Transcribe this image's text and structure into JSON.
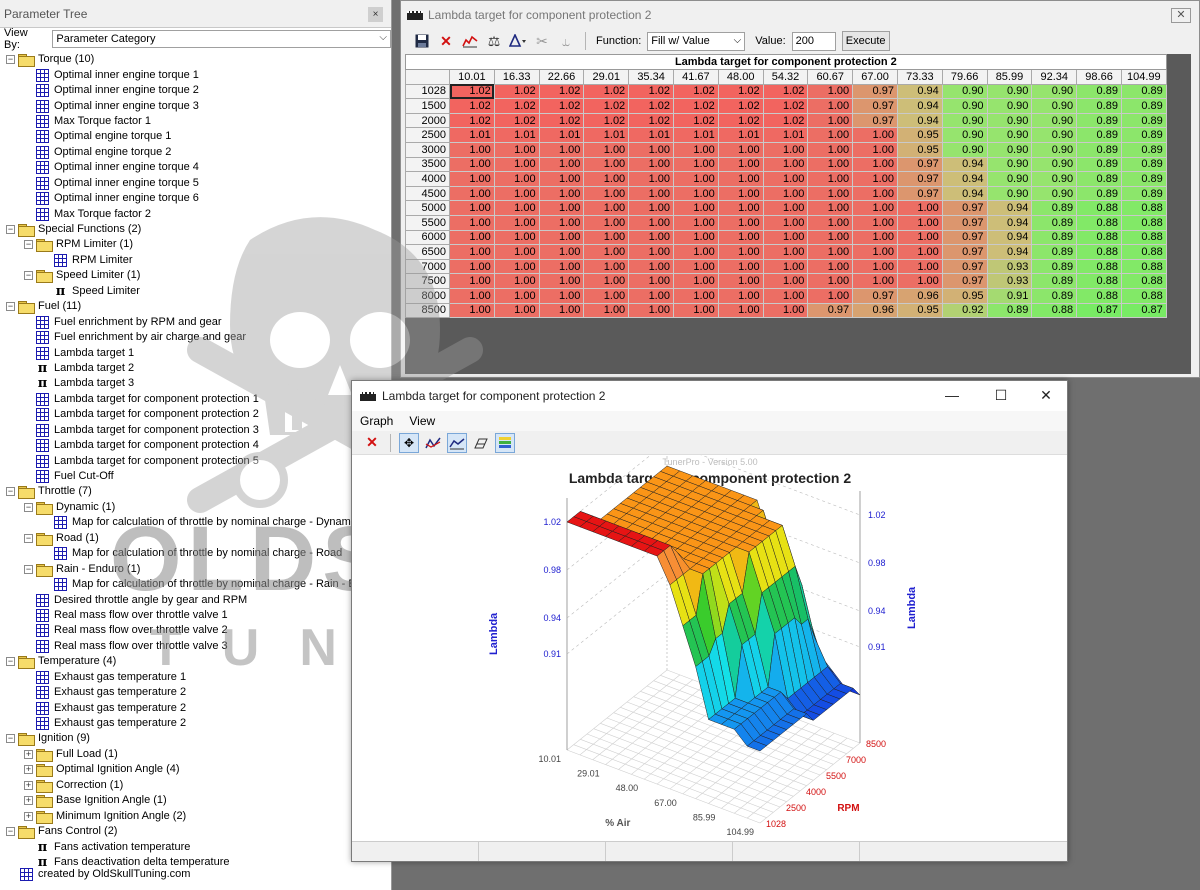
{
  "tree_panel": {
    "title": "Parameter Tree",
    "close_icon": "×",
    "view_by_label": "View By:",
    "view_by_value": "Parameter Category",
    "footer": "created by OldSkullTuning.com",
    "items": [
      {
        "level": 0,
        "type": "folder",
        "label": "Torque (10)",
        "expander": "−"
      },
      {
        "level": 1,
        "type": "grid",
        "label": "Optimal inner engine torque 1"
      },
      {
        "level": 1,
        "type": "grid",
        "label": "Optimal inner engine torque 2"
      },
      {
        "level": 1,
        "type": "grid",
        "label": "Optimal inner engine torque 3"
      },
      {
        "level": 1,
        "type": "grid",
        "label": "Max Torque factor 1"
      },
      {
        "level": 1,
        "type": "grid",
        "label": "Optimal engine torque 1"
      },
      {
        "level": 1,
        "type": "grid",
        "label": "Optimal engine torque 2"
      },
      {
        "level": 1,
        "type": "grid",
        "label": "Optimal inner engine torque 4"
      },
      {
        "level": 1,
        "type": "grid",
        "label": "Optimal inner engine torque 5"
      },
      {
        "level": 1,
        "type": "grid",
        "label": "Optimal inner engine torque 6"
      },
      {
        "level": 1,
        "type": "grid",
        "label": "Max Torque factor 2"
      },
      {
        "level": 0,
        "type": "folder",
        "label": "Special Functions (2)",
        "expander": "−"
      },
      {
        "level": 1,
        "type": "folder",
        "label": "RPM Limiter (1)",
        "expander": "−"
      },
      {
        "level": 2,
        "type": "grid",
        "label": "RPM Limiter"
      },
      {
        "level": 1,
        "type": "folder",
        "label": "Speed Limiter (1)",
        "expander": "−"
      },
      {
        "level": 2,
        "type": "pi",
        "label": "Speed Limiter"
      },
      {
        "level": 0,
        "type": "folder",
        "label": "Fuel (11)",
        "expander": "−"
      },
      {
        "level": 1,
        "type": "grid",
        "label": "Fuel enrichment by RPM and gear"
      },
      {
        "level": 1,
        "type": "grid",
        "label": "Fuel enrichment by air charge and gear"
      },
      {
        "level": 1,
        "type": "grid",
        "label": "Lambda target 1"
      },
      {
        "level": 1,
        "type": "pi",
        "label": "Lambda target 2"
      },
      {
        "level": 1,
        "type": "pi",
        "label": "Lambda target 3"
      },
      {
        "level": 1,
        "type": "grid",
        "label": "Lambda target for component protection 1"
      },
      {
        "level": 1,
        "type": "grid",
        "label": "Lambda target for component protection 2"
      },
      {
        "level": 1,
        "type": "grid",
        "label": "Lambda target for component protection 3"
      },
      {
        "level": 1,
        "type": "grid",
        "label": "Lambda target for component protection 4"
      },
      {
        "level": 1,
        "type": "grid",
        "label": "Lambda target for component protection 5"
      },
      {
        "level": 1,
        "type": "grid",
        "label": "Fuel Cut-Off"
      },
      {
        "level": 0,
        "type": "folder",
        "label": "Throttle (7)",
        "expander": "−"
      },
      {
        "level": 1,
        "type": "folder",
        "label": "Dynamic (1)",
        "expander": "−"
      },
      {
        "level": 2,
        "type": "grid",
        "label": "Map for calculation of throttle by nominal charge - Dynamic"
      },
      {
        "level": 1,
        "type": "folder",
        "label": "Road (1)",
        "expander": "−"
      },
      {
        "level": 2,
        "type": "grid",
        "label": "Map for calculation of throttle by nominal charge - Road"
      },
      {
        "level": 1,
        "type": "folder",
        "label": "Rain - Enduro (1)",
        "expander": "−"
      },
      {
        "level": 2,
        "type": "grid",
        "label": "Map for calculation of throttle by nominal charge - Rain - En"
      },
      {
        "level": 1,
        "type": "grid",
        "label": "Desired throttle angle by gear and RPM"
      },
      {
        "level": 1,
        "type": "grid",
        "label": "Real mass flow over throttle valve 1"
      },
      {
        "level": 1,
        "type": "grid",
        "label": "Real mass flow over throttle valve 2"
      },
      {
        "level": 1,
        "type": "grid",
        "label": "Real mass flow over throttle valve 3"
      },
      {
        "level": 0,
        "type": "folder",
        "label": "Temperature (4)",
        "expander": "−"
      },
      {
        "level": 1,
        "type": "grid",
        "label": "Exhaust gas temperature 1"
      },
      {
        "level": 1,
        "type": "grid",
        "label": "Exhaust gas temperature 2"
      },
      {
        "level": 1,
        "type": "grid",
        "label": "Exhaust gas temperature 2"
      },
      {
        "level": 1,
        "type": "grid",
        "label": "Exhaust gas temperature 2"
      },
      {
        "level": 0,
        "type": "folder",
        "label": "Ignition (9)",
        "expander": "−"
      },
      {
        "level": 1,
        "type": "folder",
        "label": "Full Load (1)",
        "expander": "+"
      },
      {
        "level": 1,
        "type": "folder",
        "label": "Optimal Ignition Angle (4)",
        "expander": "+"
      },
      {
        "level": 1,
        "type": "folder",
        "label": "Correction (1)",
        "expander": "+"
      },
      {
        "level": 1,
        "type": "folder",
        "label": "Base Ignition Angle (1)",
        "expander": "+"
      },
      {
        "level": 1,
        "type": "folder",
        "label": "Minimum Ignition Angle (2)",
        "expander": "+"
      },
      {
        "level": 0,
        "type": "folder",
        "label": "Fans Control (2)",
        "expander": "−"
      },
      {
        "level": 1,
        "type": "pi",
        "label": "Fans activation temperature"
      },
      {
        "level": 1,
        "type": "pi",
        "label": "Fans deactivation delta temperature"
      }
    ]
  },
  "watermark": {
    "line1": "OLDSKULL",
    "line2": "TUNING"
  },
  "table_window": {
    "title": "Lambda target for component protection 2",
    "close_icon": "✕",
    "toolbar": {
      "icons": [
        "save-icon",
        "delete-icon",
        "graph-icon",
        "balance-icon",
        "adjust-icon",
        "cut-icon",
        "merge-icon"
      ],
      "function_label": "Function:",
      "function_value": "Fill w/ Value",
      "value_label": "Value:",
      "value": "200",
      "execute_label": "Execute"
    },
    "grid_title": "Lambda target for component protection 2",
    "selected_cell": [
      0,
      0
    ]
  },
  "graph_window": {
    "title": "Lambda target for component protection 2",
    "menu": [
      "Graph",
      "View"
    ],
    "controls": {
      "minimize": "—",
      "maximize": "☐",
      "close": "✕"
    },
    "watermark_text": "TunerPro - Version 5.00",
    "chart_title": "Lambda target for component protection 2",
    "z_label": "Lambda",
    "x_label": "% Air",
    "y_label": "RPM",
    "z_ticks": [
      "1.02",
      "0.98",
      "0.94",
      "0.91"
    ],
    "x_ticks": [
      "10.01",
      "29.01",
      "48.00",
      "67.00",
      "85.99",
      "104.99"
    ],
    "y_ticks": [
      "1028",
      "2500",
      "4000",
      "5500",
      "7000",
      "8500"
    ]
  },
  "chart_data": {
    "type": "heatmap",
    "title": "Lambda target for component protection 2",
    "xlabel": "% Air",
    "ylabel": "RPM",
    "zlabel": "Lambda",
    "x": [
      10.01,
      16.33,
      22.66,
      29.01,
      35.34,
      41.67,
      48.0,
      54.32,
      60.67,
      67.0,
      73.33,
      79.66,
      85.99,
      92.34,
      98.66,
      104.99
    ],
    "y": [
      1028,
      1500,
      2000,
      2500,
      3000,
      3500,
      4000,
      4500,
      5000,
      5500,
      6000,
      6500,
      7000,
      7500,
      8000,
      8500
    ],
    "values": [
      [
        "1.02",
        "1.02",
        "1.02",
        "1.02",
        "1.02",
        "1.02",
        "1.02",
        "1.02",
        "1.00",
        "0.97",
        "0.94",
        "0.90",
        "0.90",
        "0.90",
        "0.89",
        "0.89"
      ],
      [
        "1.02",
        "1.02",
        "1.02",
        "1.02",
        "1.02",
        "1.02",
        "1.02",
        "1.02",
        "1.00",
        "0.97",
        "0.94",
        "0.90",
        "0.90",
        "0.90",
        "0.89",
        "0.89"
      ],
      [
        "1.02",
        "1.02",
        "1.02",
        "1.02",
        "1.02",
        "1.02",
        "1.02",
        "1.02",
        "1.00",
        "0.97",
        "0.94",
        "0.90",
        "0.90",
        "0.90",
        "0.89",
        "0.89"
      ],
      [
        "1.01",
        "1.01",
        "1.01",
        "1.01",
        "1.01",
        "1.01",
        "1.01",
        "1.01",
        "1.00",
        "1.00",
        "0.95",
        "0.90",
        "0.90",
        "0.90",
        "0.89",
        "0.89"
      ],
      [
        "1.00",
        "1.00",
        "1.00",
        "1.00",
        "1.00",
        "1.00",
        "1.00",
        "1.00",
        "1.00",
        "1.00",
        "0.95",
        "0.90",
        "0.90",
        "0.90",
        "0.89",
        "0.89"
      ],
      [
        "1.00",
        "1.00",
        "1.00",
        "1.00",
        "1.00",
        "1.00",
        "1.00",
        "1.00",
        "1.00",
        "1.00",
        "0.97",
        "0.94",
        "0.90",
        "0.90",
        "0.89",
        "0.89"
      ],
      [
        "1.00",
        "1.00",
        "1.00",
        "1.00",
        "1.00",
        "1.00",
        "1.00",
        "1.00",
        "1.00",
        "1.00",
        "0.97",
        "0.94",
        "0.90",
        "0.90",
        "0.89",
        "0.89"
      ],
      [
        "1.00",
        "1.00",
        "1.00",
        "1.00",
        "1.00",
        "1.00",
        "1.00",
        "1.00",
        "1.00",
        "1.00",
        "0.97",
        "0.94",
        "0.90",
        "0.90",
        "0.89",
        "0.89"
      ],
      [
        "1.00",
        "1.00",
        "1.00",
        "1.00",
        "1.00",
        "1.00",
        "1.00",
        "1.00",
        "1.00",
        "1.00",
        "1.00",
        "0.97",
        "0.94",
        "0.89",
        "0.88",
        "0.88"
      ],
      [
        "1.00",
        "1.00",
        "1.00",
        "1.00",
        "1.00",
        "1.00",
        "1.00",
        "1.00",
        "1.00",
        "1.00",
        "1.00",
        "0.97",
        "0.94",
        "0.89",
        "0.88",
        "0.88"
      ],
      [
        "1.00",
        "1.00",
        "1.00",
        "1.00",
        "1.00",
        "1.00",
        "1.00",
        "1.00",
        "1.00",
        "1.00",
        "1.00",
        "0.97",
        "0.94",
        "0.89",
        "0.88",
        "0.88"
      ],
      [
        "1.00",
        "1.00",
        "1.00",
        "1.00",
        "1.00",
        "1.00",
        "1.00",
        "1.00",
        "1.00",
        "1.00",
        "1.00",
        "0.97",
        "0.94",
        "0.89",
        "0.88",
        "0.88"
      ],
      [
        "1.00",
        "1.00",
        "1.00",
        "1.00",
        "1.00",
        "1.00",
        "1.00",
        "1.00",
        "1.00",
        "1.00",
        "1.00",
        "0.97",
        "0.93",
        "0.89",
        "0.88",
        "0.88"
      ],
      [
        "1.00",
        "1.00",
        "1.00",
        "1.00",
        "1.00",
        "1.00",
        "1.00",
        "1.00",
        "1.00",
        "1.00",
        "1.00",
        "0.97",
        "0.93",
        "0.89",
        "0.88",
        "0.88"
      ],
      [
        "1.00",
        "1.00",
        "1.00",
        "1.00",
        "1.00",
        "1.00",
        "1.00",
        "1.00",
        "1.00",
        "0.97",
        "0.96",
        "0.95",
        "0.91",
        "0.89",
        "0.88",
        "0.88"
      ],
      [
        "1.00",
        "1.00",
        "1.00",
        "1.00",
        "1.00",
        "1.00",
        "1.00",
        "1.00",
        "0.97",
        "0.96",
        "0.95",
        "0.92",
        "0.89",
        "0.88",
        "0.87",
        "0.87"
      ]
    ],
    "zlim": [
      0.87,
      1.02
    ]
  }
}
